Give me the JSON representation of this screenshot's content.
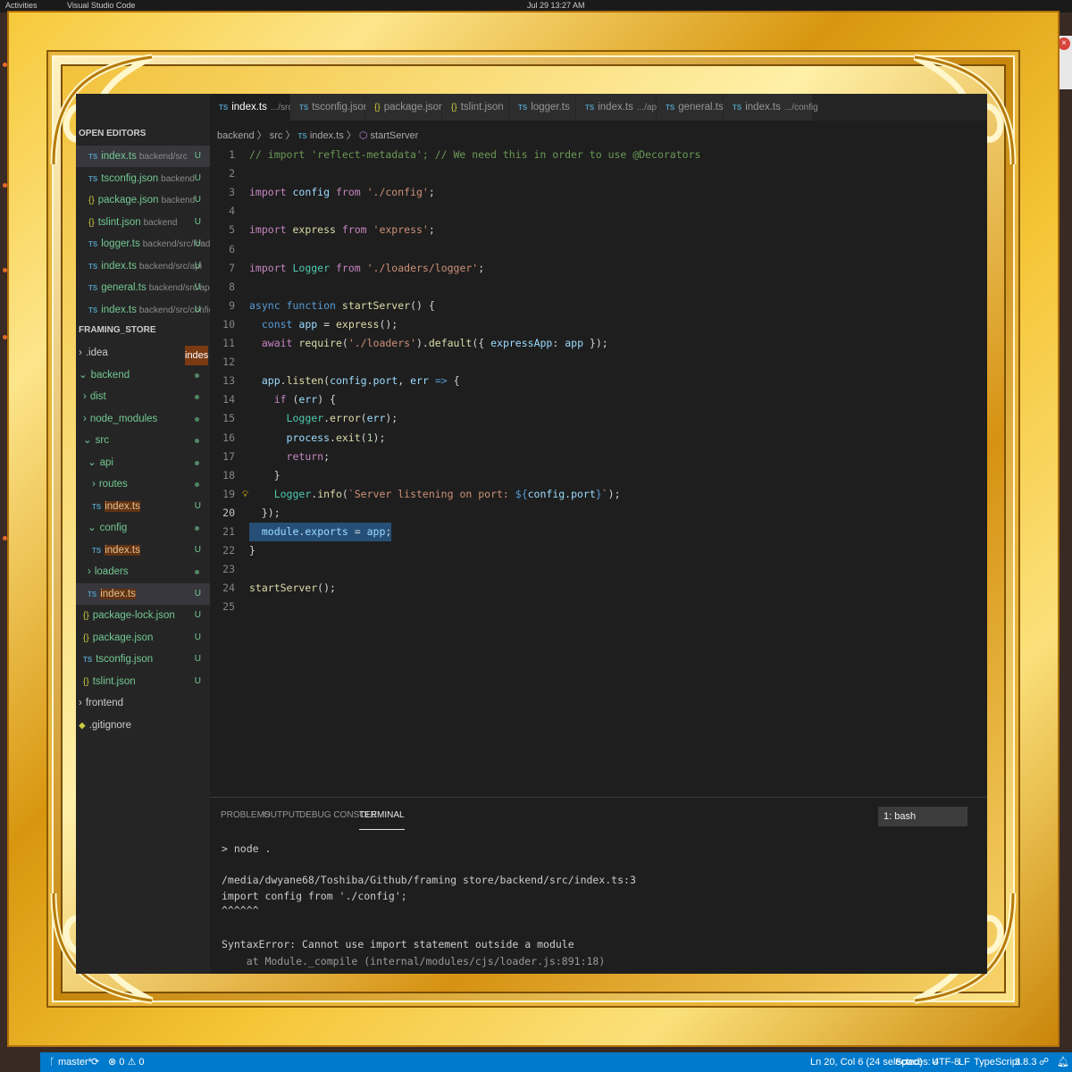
{
  "desktop": {
    "topbar_left": "Activities",
    "topbar_app": "Visual Studio Code",
    "topbar_clock": "Jul 29 13:27 AM"
  },
  "tabs": [
    {
      "icon": "TS",
      "label": "index.ts",
      "desc": ".../src",
      "close": "X"
    },
    {
      "icon": "TS",
      "label": "tsconfig.json",
      "desc": ""
    },
    {
      "icon": "{}",
      "label": "package.json",
      "desc": ""
    },
    {
      "icon": "{}",
      "label": "tslint.json",
      "desc": ""
    },
    {
      "icon": "TS",
      "label": "logger.ts",
      "desc": ""
    },
    {
      "icon": "TS",
      "label": "index.ts",
      "desc": ".../api"
    },
    {
      "icon": "TS",
      "label": "general.ts",
      "desc": ""
    },
    {
      "icon": "TS",
      "label": "index.ts",
      "desc": ".../config"
    }
  ],
  "breadcrumb": {
    "parts": [
      "backend",
      "src"
    ],
    "file": "index.ts",
    "symbol": "startServer",
    "sep": "〉"
  },
  "sidebar": {
    "open_editors_title": "OPEN EDITORS",
    "open_editors": [
      {
        "icon": "TS",
        "name": "index.ts",
        "path": "backend/src",
        "badge": "U"
      },
      {
        "icon": "TS",
        "name": "tsconfig.json",
        "path": "backend",
        "badge": "U"
      },
      {
        "icon": "{}",
        "name": "package.json",
        "path": "backend",
        "badge": "U"
      },
      {
        "icon": "{}",
        "name": "tslint.json",
        "path": "backend",
        "badge": "U"
      },
      {
        "icon": "TS",
        "name": "logger.ts",
        "path": "backend/src/loaders",
        "badge": "U"
      },
      {
        "icon": "TS",
        "name": "index.ts",
        "path": "backend/src/api",
        "badge": "U"
      },
      {
        "icon": "TS",
        "name": "general.ts",
        "path": "backend/src/api/...",
        "badge": "U"
      },
      {
        "icon": "TS",
        "name": "index.ts",
        "path": "backend/src/config",
        "badge": "U"
      }
    ],
    "project_title": "FRAMING_STORE",
    "tooltip": "indes",
    "tree": [
      {
        "chev": "›",
        "name": ".idea",
        "indent": 0
      },
      {
        "chev": "⌄",
        "name": "backend",
        "indent": 0
      },
      {
        "chev": "›",
        "name": "dist",
        "indent": 1
      },
      {
        "chev": "›",
        "name": "node_modules",
        "indent": 1
      },
      {
        "chev": "⌄",
        "name": "src",
        "indent": 1
      },
      {
        "chev": "⌄",
        "name": "api",
        "indent": 2
      },
      {
        "chev": "›",
        "name": "routes",
        "indent": 3
      },
      {
        "icon": "TS",
        "name": "index.ts",
        "indent": 3,
        "badge": "U"
      },
      {
        "chev": "⌄",
        "name": "config",
        "indent": 2
      },
      {
        "icon": "TS",
        "name": "index.ts",
        "indent": 3,
        "badge": "U"
      },
      {
        "chev": "›",
        "name": "loaders",
        "indent": 2
      },
      {
        "icon": "TS",
        "name": "index.ts",
        "indent": 2,
        "badge": "U"
      },
      {
        "icon": "{}",
        "name": "package-lock.json",
        "indent": 1,
        "badge": "U"
      },
      {
        "icon": "{}",
        "name": "package.json",
        "indent": 1,
        "badge": "U"
      },
      {
        "icon": "TS",
        "name": "tsconfig.json",
        "indent": 1,
        "badge": "U"
      },
      {
        "icon": "{}",
        "name": "tslint.json",
        "indent": 1,
        "badge": "U"
      },
      {
        "chev": "›",
        "name": "frontend",
        "indent": 0
      },
      {
        "icon": "◆",
        "name": ".gitignore",
        "indent": 0
      }
    ]
  },
  "code": {
    "lines": [
      "// import 'reflect-metadata'; // We need this in order to use @Decorators",
      "",
      "import config from './config';",
      "",
      "import express from 'express';",
      "",
      "import Logger from './loaders/logger';",
      "",
      "async function startServer() {",
      "  const app = express();",
      "  await require('./loaders').default({ expressApp: app });",
      "",
      "  app.listen(config.port, err => {",
      "    if (err) {",
      "      Logger.error(err);",
      "      process.exit(1);",
      "      return;",
      "    }",
      "    Logger.info(`Server listening on port: ${config.port}`);",
      "  });",
      "  module.exports = app;",
      "}",
      "",
      "startServer();",
      ""
    ]
  },
  "panel": {
    "tabs": [
      "PROBLEMS",
      "OUTPUT",
      "DEBUG CONSOLE",
      "TERMINAL"
    ],
    "shell": "1: bash",
    "terminal": [
      "> node .",
      "",
      "/media/dwyane68/Toshiba/Github/framing store/backend/src/index.ts:3",
      "import config from './config';",
      "^^^^^^",
      "",
      "SyntaxError: Cannot use import statement outside a module",
      "    at Module._compile (internal/modules/cjs/loader.js:891:18)"
    ]
  },
  "statusbar": {
    "branch": "master*",
    "sync": "⟳",
    "problems": "⊗ 0 ⚠ 0",
    "position": "Ln 20, Col 6 (24 selected)",
    "spaces": "Spaces: 4",
    "encoding": "UTF-8",
    "eol": "LF",
    "language": "TypeScript",
    "version": "3.8.3"
  }
}
